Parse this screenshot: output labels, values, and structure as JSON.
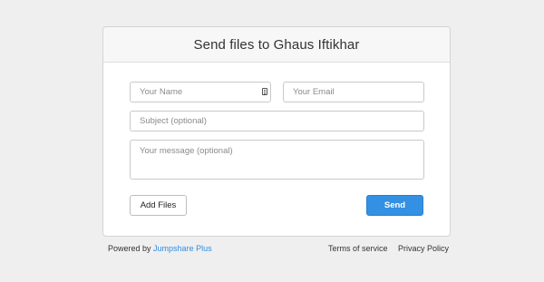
{
  "card": {
    "title": "Send files to Ghaus Iftikhar"
  },
  "form": {
    "name_placeholder": "Your Name",
    "email_placeholder": "Your Email",
    "subject_placeholder": "Subject (optional)",
    "message_placeholder": "Your message (optional)",
    "contact_icon": "contact-card-icon"
  },
  "buttons": {
    "add_files_label": "Add Files",
    "send_label": "Send"
  },
  "footer": {
    "powered_by_label": "Powered by",
    "powered_by_link": "Jumpshare Plus",
    "terms_label": "Terms of service",
    "privacy_label": "Privacy Policy"
  },
  "colors": {
    "background": "#efefef",
    "accent": "#3390e3",
    "link": "#2f8de0"
  }
}
